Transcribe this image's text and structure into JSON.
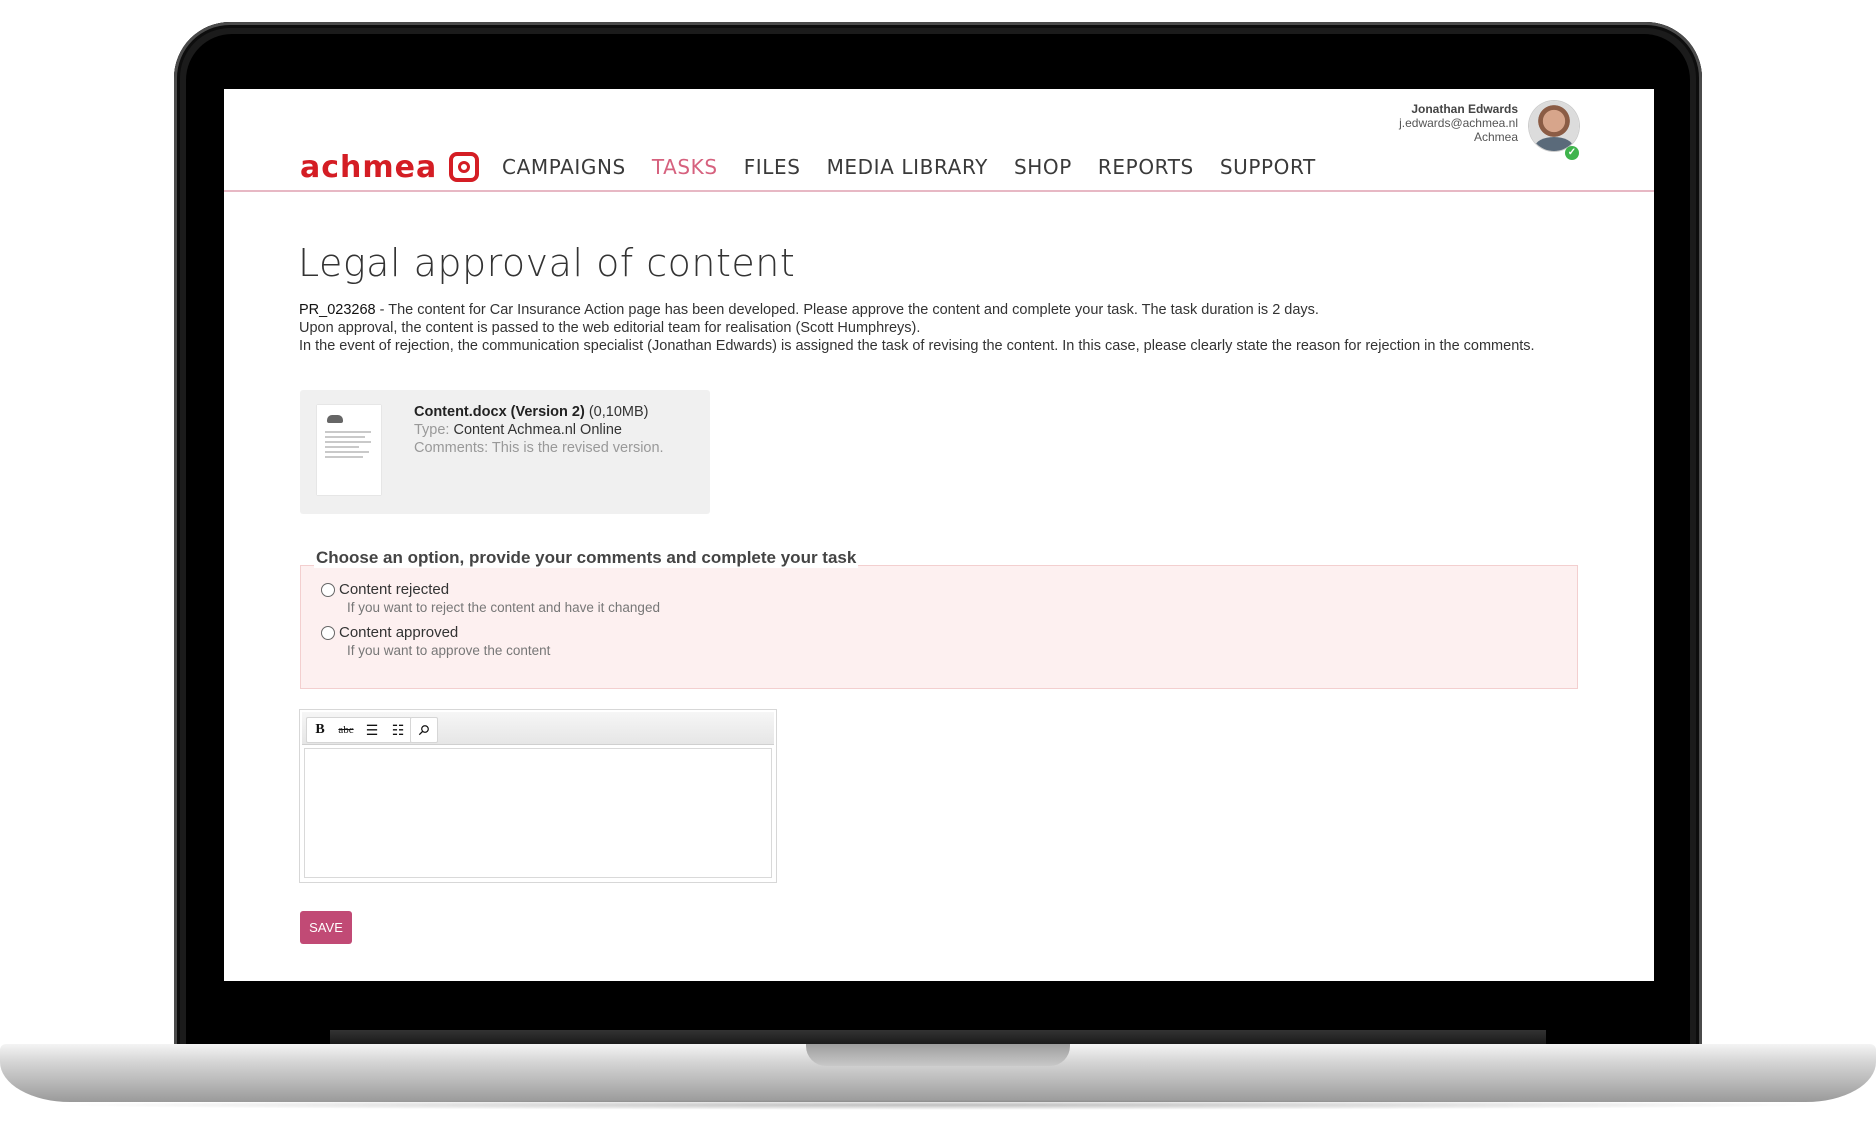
{
  "user": {
    "name": "Jonathan Edwards",
    "email": "j.edwards@achmea.nl",
    "company": "Achmea",
    "status_icon": "check-icon"
  },
  "brand": {
    "logo_text": "achmea",
    "accent": "#d41d24",
    "nav_active_color": "#d6617e",
    "button_color": "#c14a75"
  },
  "nav": {
    "items": [
      {
        "label": "CAMPAIGNS",
        "active": false
      },
      {
        "label": "TASKS",
        "active": true
      },
      {
        "label": "FILES",
        "active": false
      },
      {
        "label": "MEDIA LIBRARY",
        "active": false
      },
      {
        "label": "SHOP",
        "active": false
      },
      {
        "label": "REPORTS",
        "active": false
      },
      {
        "label": "SUPPORT",
        "active": false
      }
    ]
  },
  "page": {
    "title": "Legal approval of content",
    "project_id": "PR_023268",
    "line1": " - The content for Car Insurance Action page has been developed. Please approve the content and complete your task. The task duration is 2 days.",
    "line2": "Upon approval, the content is passed to the web editorial team for realisation (Scott Humphreys).",
    "line3": "In the event of rejection, the communication specialist (Jonathan Edwards) is assigned the task of revising the content. In this case, please clearly state the reason for rejection in the comments."
  },
  "file": {
    "name": "Content.docx (Version 2)",
    "size": "(0,10MB)",
    "type_label": "Type:",
    "type_value": "Content Achmea.nl Online",
    "comments_label": "Comments:",
    "comments_value": "This is the revised version."
  },
  "options": {
    "legend": "Choose an option, provide your comments and complete your task",
    "items": [
      {
        "label": "Content rejected",
        "hint": "If you want to reject the content and have it changed",
        "selected": false
      },
      {
        "label": "Content approved",
        "hint": "If you want to approve the content",
        "selected": false
      }
    ]
  },
  "editor": {
    "toolbar": [
      {
        "label": "B",
        "icon": "bold-icon"
      },
      {
        "label": "abc",
        "icon": "strikethrough-icon"
      },
      {
        "label": "☰",
        "icon": "bullet-list-icon"
      },
      {
        "label": "☷",
        "icon": "numbered-list-icon"
      },
      {
        "label": "⚲",
        "icon": "attachment-icon"
      }
    ],
    "content": ""
  },
  "actions": {
    "save_label": "SAVE"
  }
}
